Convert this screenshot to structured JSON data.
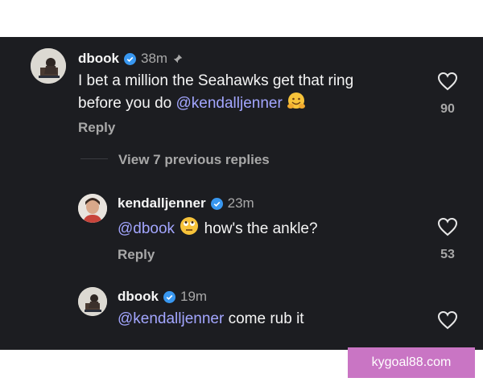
{
  "comments": [
    {
      "username": "dbook",
      "time": "38m",
      "text_line1": "I bet a million the Seahawks get that ring",
      "text_line2_pre": "before you do ",
      "mention": "@kendalljenner",
      "likes": "90",
      "reply_label": "Reply"
    },
    {
      "username": "kendalljenner",
      "time": "23m",
      "mention": "@dbook",
      "text": "how's the ankle?",
      "likes": "53",
      "reply_label": "Reply"
    },
    {
      "username": "dbook",
      "time": "19m",
      "mention": "@kendalljenner",
      "text": " come rub it"
    }
  ],
  "view_replies": "View 7 previous replies",
  "watermark": "kygoal88.com",
  "colors": {
    "panel": "#1c1d21",
    "mention": "#a3a6ff",
    "verified": "#3897f0",
    "watermark_bg": "#c975c4"
  }
}
